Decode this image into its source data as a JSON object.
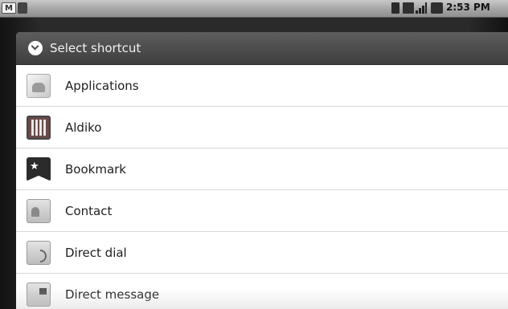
{
  "status_bar": {
    "time": "2:53 PM",
    "icons": [
      "gmail-icon",
      "phone-icon",
      "battery-icon",
      "sd-card-icon",
      "signal-icon",
      "usb-icon"
    ]
  },
  "dialog": {
    "title": "Select shortcut",
    "header_icon": "shortcut-icon",
    "items": [
      {
        "label": "Applications",
        "icon": "applications-icon"
      },
      {
        "label": "Aldiko",
        "icon": "aldiko-icon"
      },
      {
        "label": "Bookmark",
        "icon": "bookmark-icon"
      },
      {
        "label": "Contact",
        "icon": "contact-icon"
      },
      {
        "label": "Direct dial",
        "icon": "direct-dial-icon"
      },
      {
        "label": "Direct message",
        "icon": "direct-message-icon"
      }
    ]
  }
}
